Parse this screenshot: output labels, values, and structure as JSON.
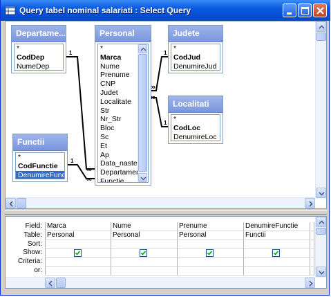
{
  "window": {
    "title": "Query tabel nominal salariati : Select Query"
  },
  "tables": [
    {
      "id": "departament",
      "title": "Departame...",
      "fields": [
        {
          "name": "*",
          "key": false,
          "selected": false
        },
        {
          "name": "CodDep",
          "key": true,
          "selected": false
        },
        {
          "name": "NumeDep",
          "key": false,
          "selected": false
        }
      ]
    },
    {
      "id": "personal",
      "title": "Personal",
      "fields": [
        {
          "name": "*",
          "key": false,
          "selected": false
        },
        {
          "name": "Marca",
          "key": true,
          "selected": false
        },
        {
          "name": "Nume",
          "key": false,
          "selected": false
        },
        {
          "name": "Prenume",
          "key": false,
          "selected": false
        },
        {
          "name": "CNP",
          "key": false,
          "selected": false
        },
        {
          "name": "Judet",
          "key": false,
          "selected": false
        },
        {
          "name": "Localitate",
          "key": false,
          "selected": false
        },
        {
          "name": "Str",
          "key": false,
          "selected": false
        },
        {
          "name": "Nr_Str",
          "key": false,
          "selected": false
        },
        {
          "name": "Bloc",
          "key": false,
          "selected": false
        },
        {
          "name": "Sc",
          "key": false,
          "selected": false
        },
        {
          "name": "Et",
          "key": false,
          "selected": false
        },
        {
          "name": "Ap",
          "key": false,
          "selected": false
        },
        {
          "name": "Data_nasterii",
          "key": false,
          "selected": false
        },
        {
          "name": "Departament",
          "key": false,
          "selected": false
        },
        {
          "name": "Functie",
          "key": false,
          "selected": false
        }
      ]
    },
    {
      "id": "judete",
      "title": "Judete",
      "fields": [
        {
          "name": "*",
          "key": false,
          "selected": false
        },
        {
          "name": "CodJud",
          "key": true,
          "selected": false
        },
        {
          "name": "DenumireJud",
          "key": false,
          "selected": false
        }
      ]
    },
    {
      "id": "localitati",
      "title": "Localitati",
      "fields": [
        {
          "name": "*",
          "key": false,
          "selected": false
        },
        {
          "name": "CodLoc",
          "key": true,
          "selected": false
        },
        {
          "name": "DenumireLoc",
          "key": false,
          "selected": false
        }
      ]
    },
    {
      "id": "functii",
      "title": "Functii",
      "fields": [
        {
          "name": "*",
          "key": false,
          "selected": false
        },
        {
          "name": "CodFunctie",
          "key": true,
          "selected": false
        },
        {
          "name": "DenumireFunctie",
          "key": false,
          "selected": true
        }
      ]
    }
  ],
  "relations": {
    "one_label": "1",
    "many_label": "∞"
  },
  "grid": {
    "row_labels": [
      "Field:",
      "Table:",
      "Sort:",
      "Show:",
      "Criteria:",
      "or:"
    ],
    "columns": [
      {
        "field": "Marca",
        "table": "Personal",
        "sort": "",
        "show": true,
        "criteria": "",
        "or": ""
      },
      {
        "field": "Nume",
        "table": "Personal",
        "sort": "",
        "show": true,
        "criteria": "",
        "or": ""
      },
      {
        "field": "Prenume",
        "table": "Personal",
        "sort": "",
        "show": true,
        "criteria": "",
        "or": ""
      },
      {
        "field": "DenumireFunctie",
        "table": "Functii",
        "sort": "",
        "show": true,
        "criteria": "",
        "or": ""
      }
    ]
  },
  "colors": {
    "titlebar": "#0a5ae0",
    "table_header": "#7a96dd",
    "selection": "#316ac5"
  }
}
